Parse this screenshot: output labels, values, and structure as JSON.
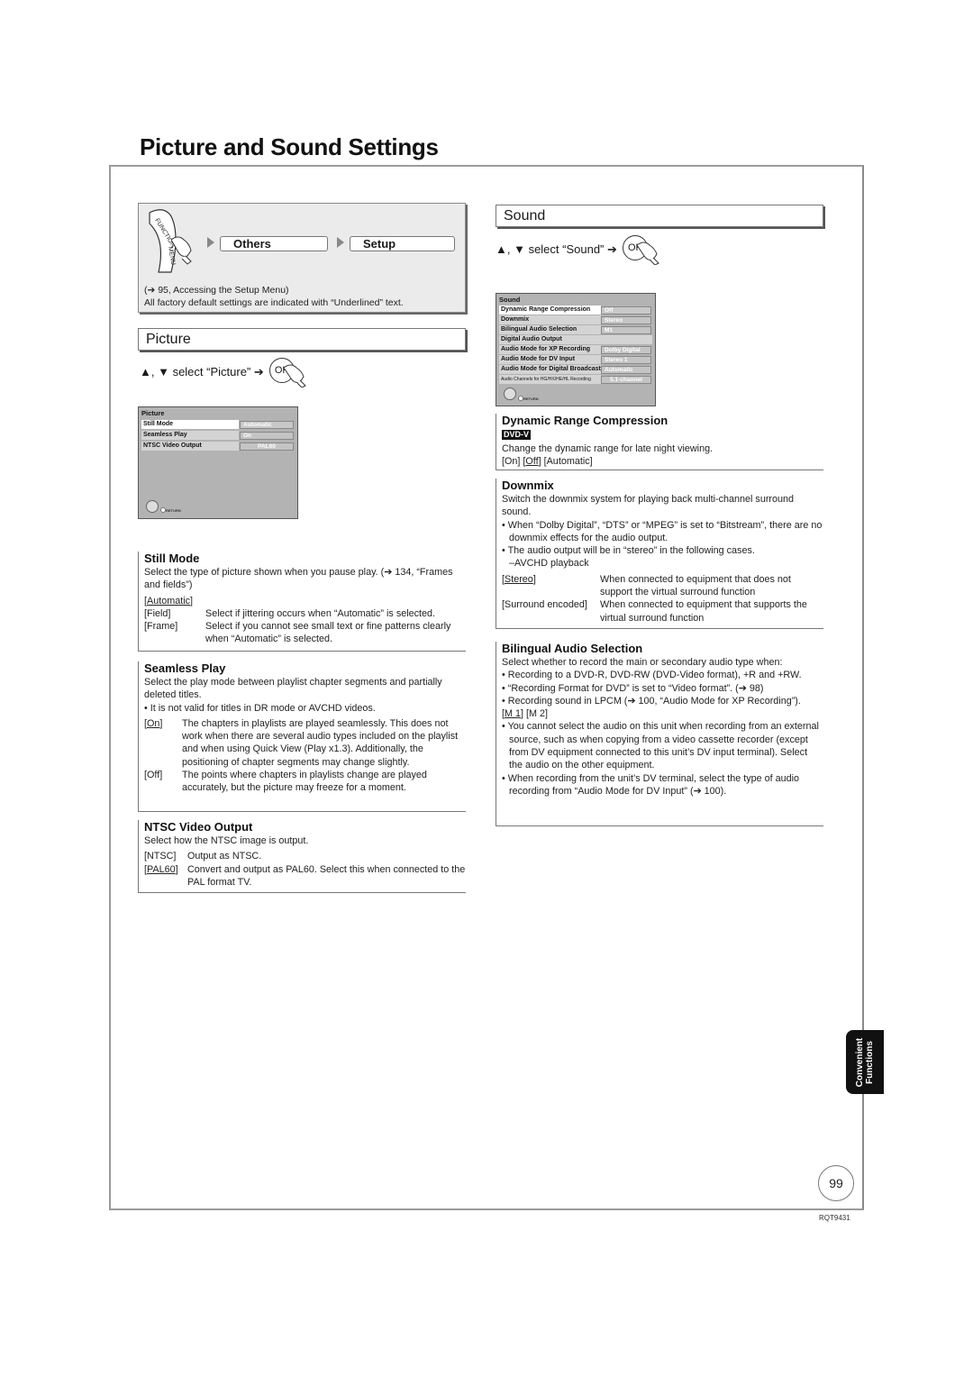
{
  "page": {
    "title": "Picture and Sound Settings",
    "side_tab": [
      "Convenient",
      "Functions"
    ],
    "page_number": "99",
    "doc_code": "RQT9431"
  },
  "function_menu": {
    "dial_label": "FUNCTION MENU",
    "steps": [
      "Others",
      "Setup"
    ],
    "note1": "(➔ 95, Accessing the Setup Menu)",
    "note2": "All factory default settings are indicated with “Underlined” text."
  },
  "picture": {
    "header": "Picture",
    "select_text": "▲, ▼ select “Picture” ➔",
    "ok_label": "OK",
    "osd": {
      "title": "Picture",
      "rows": [
        {
          "label": "Still Mode",
          "value": "Automatic"
        },
        {
          "label": "Seamless Play",
          "value": "On"
        },
        {
          "label": "NTSC Video Output",
          "value": "PAL60"
        }
      ],
      "return_label": "RETURN"
    },
    "still_mode": {
      "title": "Still Mode",
      "desc": "Select the type of picture shown when you pause play. (➔ 134, “Frames and fields”)",
      "options": [
        {
          "key": "[Automatic]",
          "underlined": "Automatic",
          "text": ""
        },
        {
          "key": "[Field]",
          "text": "Select if jittering occurs when “Automatic” is selected."
        },
        {
          "key": "[Frame]",
          "text": "Select if you cannot see small text or fine patterns clearly when “Automatic” is selected."
        }
      ]
    },
    "seamless_play": {
      "title": "Seamless Play",
      "desc": "Select the play mode between playlist chapter segments and partially deleted titles.",
      "bullet": "• It is not valid for titles in DR mode or AVCHD videos.",
      "options": [
        {
          "key": "[On]",
          "underlined": "On",
          "text": "The chapters in playlists are played seamlessly. This does not work when there are several audio types included on the playlist and when using Quick View (Play x1.3). Additionally, the positioning of chapter segments may change slightly."
        },
        {
          "key": "[Off]",
          "text": "The points where chapters in playlists change are played accurately, but the picture may freeze for a moment."
        }
      ]
    },
    "ntsc_output": {
      "title": "NTSC Video Output",
      "desc": "Select how the NTSC image is output.",
      "options": [
        {
          "key": "[NTSC]",
          "text": "Output as NTSC."
        },
        {
          "key": "[PAL60]",
          "underlined": "PAL60",
          "text": "Convert and output as PAL60. Select this when connected to the PAL format TV."
        }
      ]
    }
  },
  "sound": {
    "header": "Sound",
    "select_text": "▲, ▼ select “Sound” ➔",
    "ok_label": "OK",
    "osd": {
      "title": "Sound",
      "rows": [
        {
          "label": "Dynamic Range Compression",
          "value": "Off"
        },
        {
          "label": "Downmix",
          "value": "Stereo"
        },
        {
          "label": "Bilingual Audio Selection",
          "value": "M1"
        },
        {
          "label": "Digital Audio Output",
          "value": ""
        },
        {
          "label": "Audio Mode for XP Recording",
          "value": "Dolby Digital"
        },
        {
          "label": "Audio Mode for DV Input",
          "value": "Stereo 1"
        },
        {
          "label": "Audio Mode for Digital Broadcast",
          "value": "Automatic"
        },
        {
          "label": "Audio Channels for HG/HX/HE/HL Recording",
          "value": "5.1-channel"
        }
      ],
      "return_label": "RETURN"
    },
    "drc": {
      "title": "Dynamic Range Compression",
      "badge": "DVD-V",
      "desc": "Change the dynamic range for late night viewing.",
      "options_line": [
        "[On] ",
        "[",
        "Off",
        "] [Automatic]"
      ]
    },
    "downmix": {
      "title": "Downmix",
      "desc": "Switch the downmix system for playing back multi-channel surround sound.",
      "bullets": [
        "• When “Dolby Digital”, “DTS” or “MPEG” is set to “Bitstream”, there are no downmix effects for the audio output.",
        "• The audio output will be in “stereo” in the following cases."
      ],
      "sub": "–AVCHD playback",
      "options": [
        {
          "key": "[Stereo]",
          "underlined": "Stereo",
          "text": "When connected to equipment that does not support the virtual surround function"
        },
        {
          "key": "[Surround encoded]",
          "text": "When connected to equipment that supports the virtual surround function"
        }
      ]
    },
    "bilingual": {
      "title": "Bilingual Audio Selection",
      "desc": "Select whether to record the main or secondary audio type when:",
      "bullets": [
        "• Recording to a DVD-R, DVD-RW (DVD-Video format), +R and +RW.",
        "• “Recording Format for DVD” is set to “Video format”. (➔ 98)",
        "• Recording sound in LPCM (➔ 100, “Audio Mode for XP Recording”)."
      ],
      "options_line": [
        "[",
        "M 1",
        "] [M 2]"
      ],
      "bullets2": [
        "• You cannot select the audio on this unit when recording from an external source, such as when copying from a video cassette recorder (except from DV equipment connected to this unit’s DV input terminal). Select the audio on the other equipment.",
        "• When recording from the unit’s DV terminal, select the type of audio recording from “Audio Mode for DV Input” (➔ 100)."
      ]
    }
  }
}
